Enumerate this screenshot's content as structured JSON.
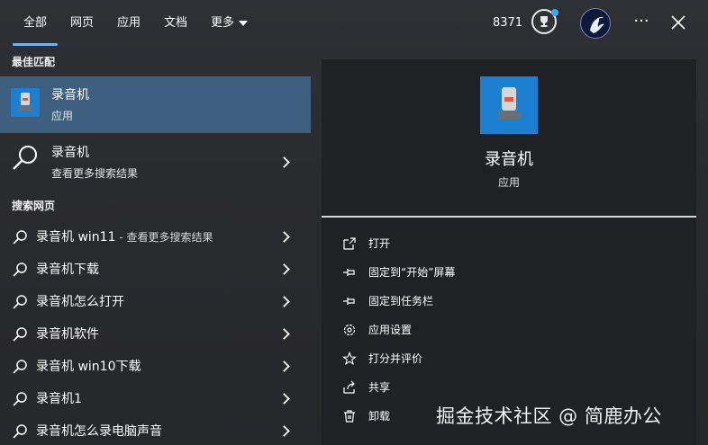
{
  "tabs": [
    {
      "label": "全部"
    },
    {
      "label": "网页"
    },
    {
      "label": "应用"
    },
    {
      "label": "文档"
    },
    {
      "label": "更多"
    }
  ],
  "header": {
    "points": "8371",
    "more_icon": "ellipsis-icon",
    "close_icon": "close-icon"
  },
  "best_match": {
    "section_title": "最佳匹配",
    "title": "录音机",
    "subtitle": "应用"
  },
  "search_more": {
    "title": "录音机",
    "subtitle": "查看更多搜索结果"
  },
  "web": {
    "section_title": "搜索网页",
    "items": [
      {
        "label": "录音机 win11",
        "hint": " - 查看更多搜索结果"
      },
      {
        "label": "录音机下载",
        "hint": ""
      },
      {
        "label": "录音机怎么打开",
        "hint": ""
      },
      {
        "label": "录音机软件",
        "hint": ""
      },
      {
        "label": "录音机 win10下载",
        "hint": ""
      },
      {
        "label": "录音机1",
        "hint": ""
      },
      {
        "label": "录音机怎么录电脑声音",
        "hint": ""
      }
    ]
  },
  "detail": {
    "title": "录音机",
    "subtitle": "应用",
    "actions": [
      {
        "label": "打开",
        "icon": "open-icon"
      },
      {
        "label": "固定到“开始”屏幕",
        "icon": "pin-icon"
      },
      {
        "label": "固定到任务栏",
        "icon": "pin-icon"
      },
      {
        "label": "应用设置",
        "icon": "gear-icon"
      },
      {
        "label": "打分并评价",
        "icon": "star-icon"
      },
      {
        "label": "共享",
        "icon": "share-icon"
      },
      {
        "label": "卸载",
        "icon": "trash-icon"
      }
    ]
  },
  "watermark": "掘金技术社区 @ 简鹿办公",
  "colors": {
    "accent": "#6fb3f0",
    "selected_row": "#3f5f80",
    "app_icon": "#1d7fcf",
    "detail_bg": "#202124"
  }
}
